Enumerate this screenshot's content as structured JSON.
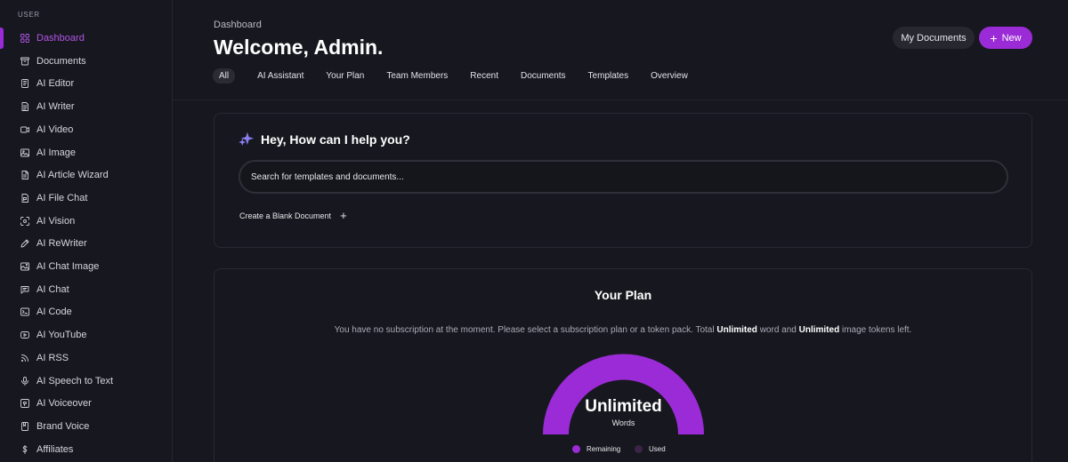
{
  "sidebar": {
    "heading": "USER",
    "items": [
      {
        "label": "Dashboard",
        "icon": "grid-icon"
      },
      {
        "label": "Documents",
        "icon": "archive-icon"
      },
      {
        "label": "AI Editor",
        "icon": "notebook-icon"
      },
      {
        "label": "AI Writer",
        "icon": "document-icon"
      },
      {
        "label": "AI Video",
        "icon": "video-icon"
      },
      {
        "label": "AI Image",
        "icon": "image-icon"
      },
      {
        "label": "AI Article Wizard",
        "icon": "file-text-icon"
      },
      {
        "label": "AI File Chat",
        "icon": "file-chat-icon"
      },
      {
        "label": "AI Vision",
        "icon": "scan-icon"
      },
      {
        "label": "AI ReWriter",
        "icon": "pencil-icon"
      },
      {
        "label": "AI Chat Image",
        "icon": "photo-icon"
      },
      {
        "label": "AI Chat",
        "icon": "chat-icon"
      },
      {
        "label": "AI Code",
        "icon": "terminal-icon"
      },
      {
        "label": "AI YouTube",
        "icon": "youtube-icon"
      },
      {
        "label": "AI RSS",
        "icon": "rss-icon"
      },
      {
        "label": "AI Speech to Text",
        "icon": "microphone-icon"
      },
      {
        "label": "AI Voiceover",
        "icon": "voiceover-icon"
      },
      {
        "label": "Brand Voice",
        "icon": "bookmark-icon"
      },
      {
        "label": "Affiliates",
        "icon": "dollar-icon"
      }
    ]
  },
  "header": {
    "breadcrumb": "Dashboard",
    "title": "Welcome, Admin.",
    "my_documents_label": "My Documents",
    "new_label": "New"
  },
  "tabs": [
    "All",
    "AI Assistant",
    "Your Plan",
    "Team Members",
    "Recent",
    "Documents",
    "Templates",
    "Overview"
  ],
  "assistant": {
    "title": "Hey, How can I help you?",
    "search_placeholder": "Search for templates and documents...",
    "blank_doc_label": "Create a Blank Document"
  },
  "plan": {
    "title": "Your Plan",
    "desc_prefix": "You have no subscription at the moment. Please select a subscription plan or a token pack. Total ",
    "word_tokens": "Unlimited",
    "desc_middle": " word and ",
    "image_tokens": "Unlimited",
    "desc_suffix": " image tokens left.",
    "gauge_value": "Unlimited",
    "gauge_unit": "Words",
    "remaining_fraction": 1.0,
    "legend_remaining": "Remaining",
    "legend_used": "Used"
  },
  "colors": {
    "accent": "#9b2bd6",
    "used": "#3b2446",
    "background": "#17181f"
  }
}
